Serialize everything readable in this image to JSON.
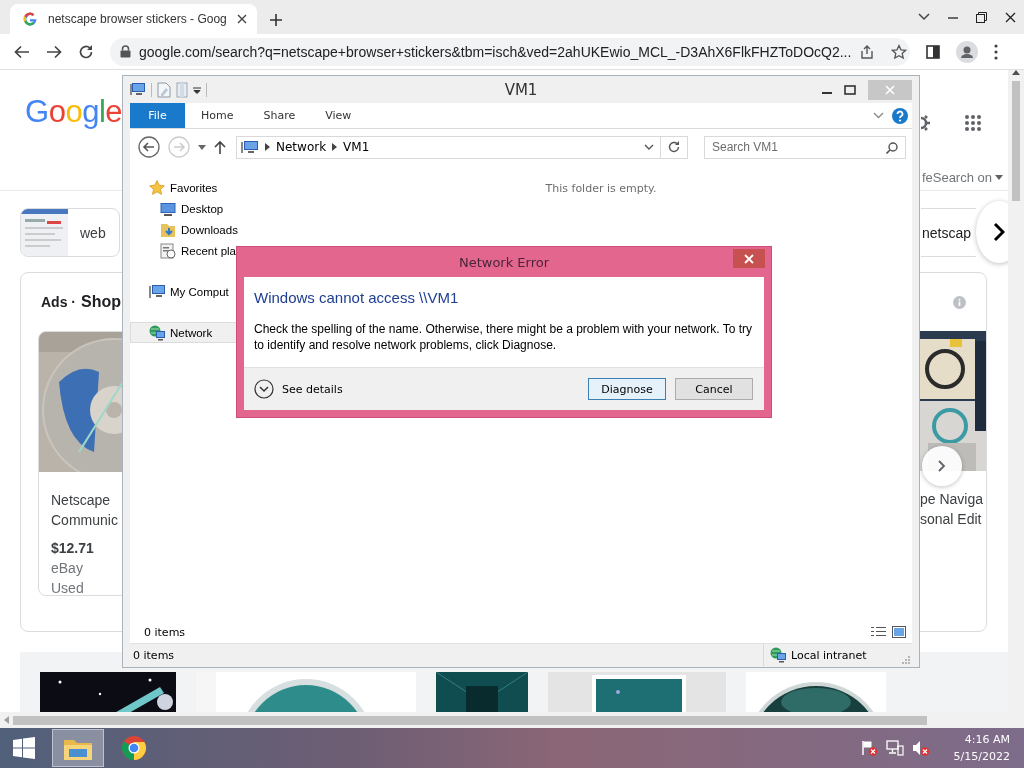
{
  "browser": {
    "tabs": [
      {
        "title": "netscape browser stickers - Goog",
        "selected": true
      }
    ],
    "url": "google.com/search?q=netscape+browser+stickers&tbm=isch&ved=2ahUKEwio_MCL_-D3AhX6FlkFHZToDOcQ2..."
  },
  "google": {
    "logo": "Google",
    "safesearch": "feSearch on",
    "chips": [
      {
        "kind": "thumbnail",
        "label": "web"
      },
      {
        "kind": "text",
        "label": "netscap"
      }
    ],
    "ads": {
      "prefix": "Ads ·",
      "title": "Shop",
      "products": [
        {
          "kind": "cd",
          "title_lines": [
            "Netscape",
            "Communic"
          ],
          "price": "$12.71",
          "store": "eBay",
          "condition": "Used"
        },
        {
          "kind": "boxes",
          "title_lines": [
            "pe Naviga",
            "sonal Edit"
          ]
        }
      ]
    }
  },
  "explorer": {
    "title": "VM1",
    "ribbon": [
      {
        "label": "File",
        "kind": "menu"
      },
      {
        "label": "Home",
        "kind": "tab"
      },
      {
        "label": "Share",
        "kind": "tab"
      },
      {
        "label": "View",
        "kind": "tab"
      }
    ],
    "path": [
      "Network",
      "VM1"
    ],
    "search": {
      "placeholder": "Search VM1"
    },
    "nav": [
      {
        "label": "Favorites",
        "kind": "star",
        "selected": false,
        "children": [
          {
            "label": "Desktop",
            "kind": "desktop",
            "selected": false
          },
          {
            "label": "Downloads",
            "kind": "downloads",
            "selected": false
          },
          {
            "label": "Recent pla",
            "kind": "recent",
            "selected": false
          }
        ]
      },
      {
        "label": "My Comput",
        "kind": "computer",
        "selected": false
      },
      {
        "label": "Network",
        "kind": "network",
        "selected": true
      }
    ],
    "empty_message": "This folder is empty.",
    "item_count": "0 items",
    "status_bar": {
      "item_count": "0 items",
      "zone": "Local intranet"
    }
  },
  "dialog": {
    "title": "Network Error",
    "heading": "Windows cannot access \\\\VM1",
    "message": "Check the spelling of the name. Otherwise, there might be a problem with your network. To try to identify and resolve network problems, click Diagnose.",
    "details_label": "See details",
    "expanded": false,
    "buttons": [
      {
        "label": "Diagnose",
        "default": true
      },
      {
        "label": "Cancel",
        "default": false
      }
    ]
  },
  "taskbar": {
    "apps": [
      {
        "kind": "explorer",
        "active": true
      },
      {
        "kind": "chrome",
        "active": false
      }
    ],
    "clock": {
      "time": "4:16 AM",
      "date": "5/15/2022"
    }
  }
}
